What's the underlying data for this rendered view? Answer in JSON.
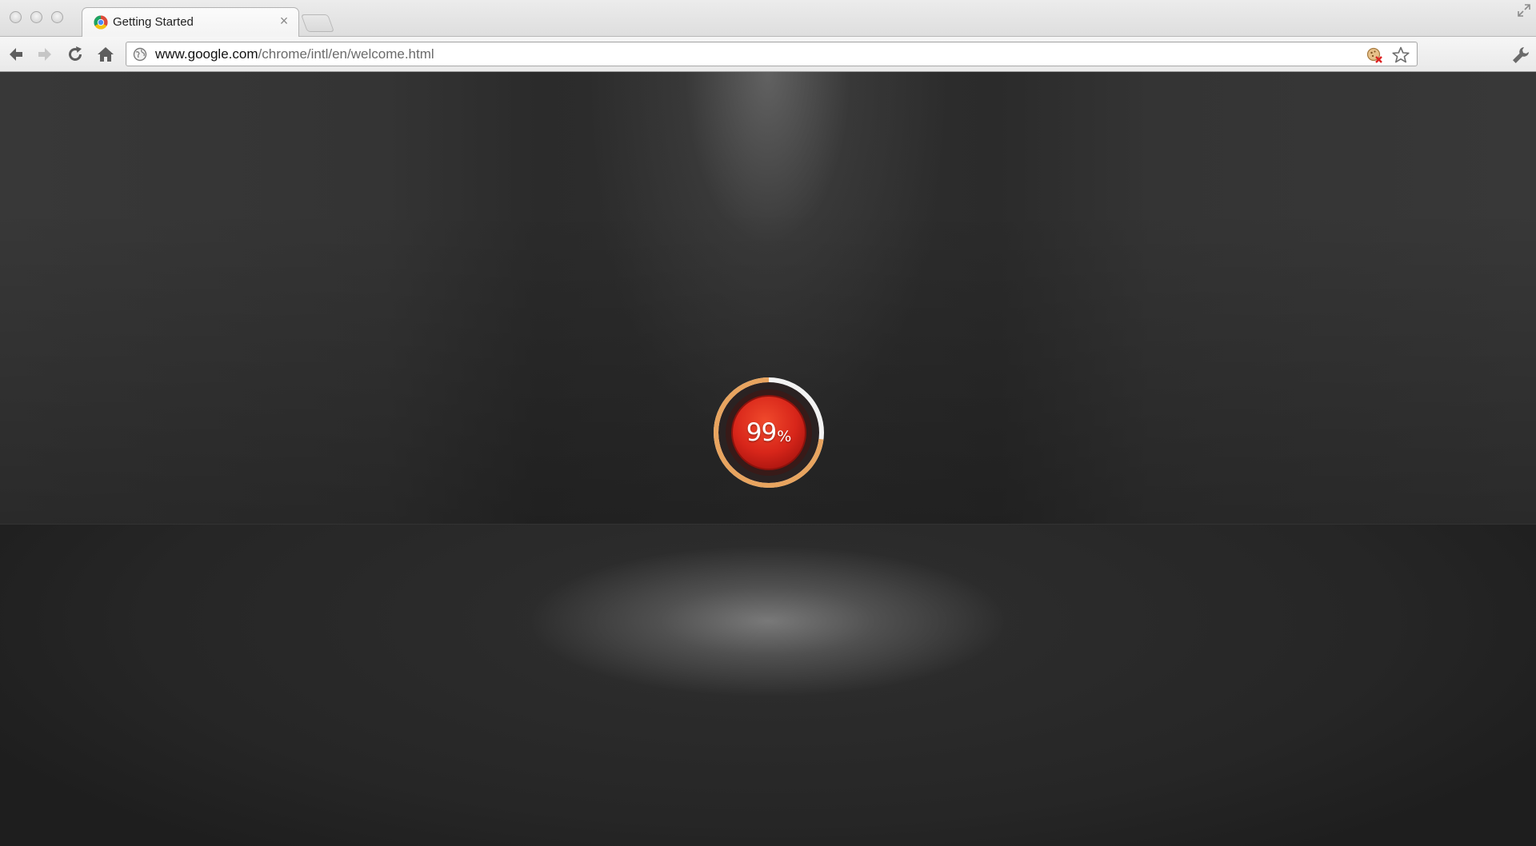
{
  "window": {
    "tab": {
      "title": "Getting Started",
      "close_glyph": "×"
    }
  },
  "toolbar": {
    "url_host": "www.google.com",
    "url_path": "/chrome/intl/en/welcome.html"
  },
  "loader": {
    "value": "99",
    "unit": "%",
    "progress_fraction": 0.99,
    "colors": {
      "ring_progress": "#e8a45f",
      "ring_track": "#f2f2f2",
      "core": "#d8261a"
    }
  },
  "icons": [
    "close-window-icon",
    "minimize-window-icon",
    "zoom-window-icon",
    "chrome-favicon",
    "close-tab-icon",
    "new-tab-icon",
    "fullscreen-icon",
    "back-arrow-icon",
    "forward-arrow-icon",
    "reload-icon",
    "home-icon",
    "globe-icon",
    "cookie-blocked-icon",
    "star-icon",
    "wrench-icon"
  ]
}
